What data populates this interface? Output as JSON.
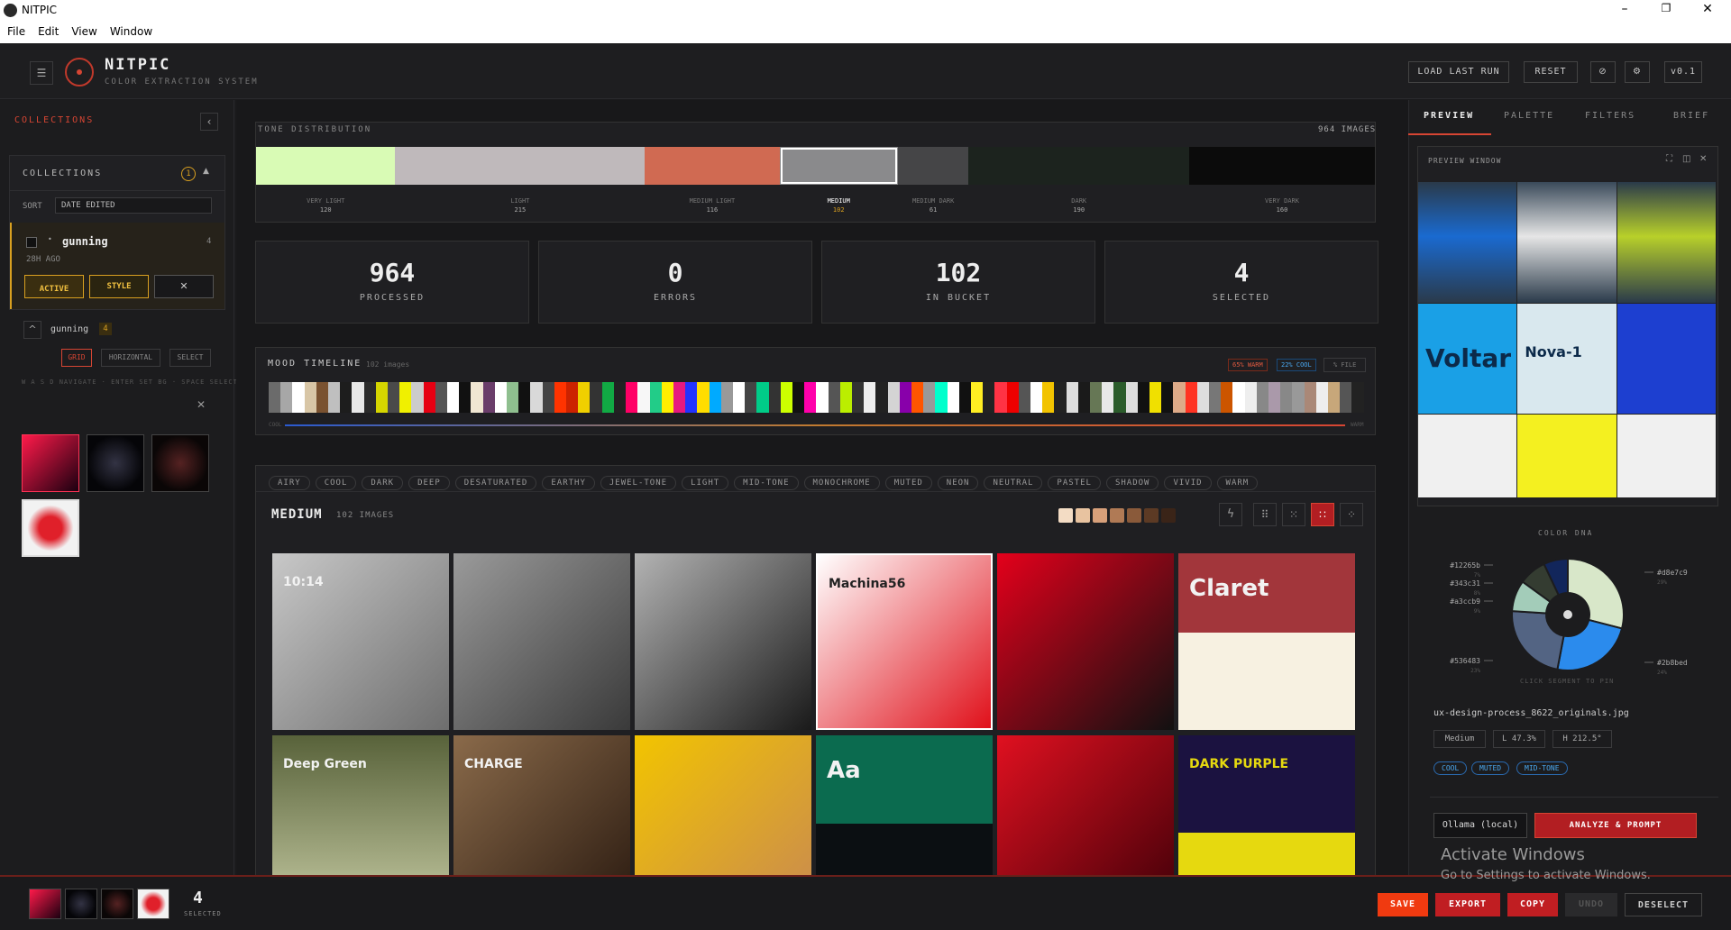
{
  "window": {
    "title": "NITPIC",
    "min": "–",
    "max": "❐",
    "close": "✕"
  },
  "menu": [
    "File",
    "Edit",
    "View",
    "Window"
  ],
  "header": {
    "brand": "NITPIC",
    "tagline": "COLOR EXTRACTION SYSTEM",
    "load_last_run": "LOAD LAST RUN",
    "reset": "RESET",
    "version": "v0.1"
  },
  "sidebar": {
    "title": "COLLECTIONS",
    "collapse_icon": "‹",
    "panel_title": "COLLECTIONS",
    "panel_count": "1",
    "sort_label": "SORT",
    "sort_value": "DATE EDITED",
    "collection": {
      "name": "gunning",
      "count": "4",
      "age": "28H AGO",
      "active": "ACTIVE",
      "style": "STYLE",
      "remove": "✕"
    },
    "group": {
      "name": "gunning",
      "count": "4"
    },
    "view_modes": [
      "GRID",
      "HORIZONTAL",
      "SELECT"
    ],
    "hint": "W A S D NAVIGATE · ENTER SET BG · SPACE SELECT",
    "close": "✕"
  },
  "tone": {
    "title": "TONE DISTRIBUTION",
    "total": "964 IMAGES",
    "segments": [
      {
        "label": "VERY LIGHT",
        "count": "120",
        "color": "#d9fbb5",
        "share": 120
      },
      {
        "label": "LIGHT",
        "count": "215",
        "color": "#bfb9bb",
        "share": 215
      },
      {
        "label": "MEDIUM LIGHT",
        "count": "116",
        "color": "#d06a52",
        "share": 116
      },
      {
        "label": "MEDIUM",
        "count": "102",
        "color": "#8a8a8c",
        "share": 102,
        "active": true
      },
      {
        "label": "MEDIUM DARK",
        "count": "61",
        "color": "#454547",
        "share": 61
      },
      {
        "label": "DARK",
        "count": "190",
        "color": "#1c231e",
        "share": 190
      },
      {
        "label": "VERY DARK",
        "count": "160",
        "color": "#0b0b0b",
        "share": 160
      }
    ]
  },
  "stats": [
    {
      "value": "964",
      "label": "PROCESSED"
    },
    {
      "value": "0",
      "label": "ERRORS"
    },
    {
      "value": "102",
      "label": "IN BUCKET"
    },
    {
      "value": "4",
      "label": "SELECTED"
    }
  ],
  "mood": {
    "title": "MOOD TIMELINE",
    "count": "102 images",
    "warm": "65% WARM",
    "cool": "22% COOL",
    "file": "% FILE",
    "left_label": "COOL",
    "right_label": "WARM",
    "colors": [
      "#6b6b6b",
      "#a7a7a7",
      "#ffffff",
      "#d8c6a6",
      "#7a5230",
      "#bfbfbf",
      "#1d1d1d",
      "#e8e8e8",
      "#2b2b2b",
      "#d6d600",
      "#4a4a4a",
      "#f0f000",
      "#ccc",
      "#e60012",
      "#555",
      "#ffffff",
      "#111",
      "#f0e6d2",
      "#6a3d6a",
      "#ffffff",
      "#8fbf8f",
      "#111",
      "#d9d9d9",
      "#444",
      "#ff3300",
      "#cc2200",
      "#f0d000",
      "#333",
      "#11aa44",
      "#222",
      "#ff0066",
      "#f7f7f7",
      "#22cc88",
      "#ffee00",
      "#e6197f",
      "#2233ff",
      "#ffdd00",
      "#00aaff",
      "#999",
      "#ffffff",
      "#444",
      "#00cc88",
      "#333",
      "#ccff00",
      "#111",
      "#ff00aa",
      "#ffffff",
      "#555",
      "#bbee00",
      "#333",
      "#eee",
      "#222",
      "#d4d4d4",
      "#8800aa",
      "#ff5500",
      "#999",
      "#00ffcc",
      "#ffffff",
      "#111",
      "#ffee22",
      "#222",
      "#ff3344",
      "#ee0000",
      "#555",
      "#ffffff",
      "#f2c300",
      "#222",
      "#dddddd",
      "#1a1a1a",
      "#667755",
      "#e8e8e8",
      "#2b5c2b",
      "#ddd",
      "#111",
      "#f0e000",
      "#111",
      "#ddaa88",
      "#ff3322",
      "#dddddd",
      "#777",
      "#cc5500",
      "#ffffff",
      "#eee",
      "#888",
      "#aa99aa",
      "#888",
      "#999",
      "#aa8877",
      "#eeeeee",
      "#c7a77a",
      "#555",
      "#222"
    ]
  },
  "filters": [
    "AIRY",
    "COOL",
    "DARK",
    "DEEP",
    "DESATURATED",
    "EARTHY",
    "JEWEL-TONE",
    "LIGHT",
    "MID-TONE",
    "MONOCHROME",
    "MUTED",
    "NEON",
    "NEUTRAL",
    "PASTEL",
    "SHADOW",
    "VIVID",
    "WARM"
  ],
  "gallery": {
    "title": "MEDIUM",
    "count": "102 IMAGES",
    "swatches": [
      "#f3dcc4",
      "#e8c3a0",
      "#d7a07a",
      "#b07a55",
      "#8a5a3a",
      "#5c3a24",
      "#3a2418"
    ],
    "items": [
      {
        "bg": "linear-gradient(135deg,#c8c8c8,#6e6e6e)",
        "text": "10:14"
      },
      {
        "bg": "linear-gradient(135deg,#9a9a9a,#3a3a3a)",
        "text": ""
      },
      {
        "bg": "linear-gradient(135deg,#b3b3b3,#1a1a1a)",
        "text": ""
      },
      {
        "bg": "linear-gradient(135deg,#ffffff,#e0101a)",
        "text": "Machina56"
      },
      {
        "bg": "linear-gradient(135deg,#e4001b,#111)",
        "text": ""
      },
      {
        "bg": "linear-gradient(180deg,#a2363b 45%,#f7f1e1 45%)",
        "text": "Claret"
      },
      {
        "bg": "linear-gradient(180deg,#58623a,#c3c8a0)",
        "text": "Deep Green"
      },
      {
        "bg": "linear-gradient(135deg,#8a6a4a,#2a1a10)",
        "text": "CHARGE"
      },
      {
        "bg": "linear-gradient(135deg,#f2c400,#c98a50)",
        "text": ""
      },
      {
        "bg": "linear-gradient(180deg,#0b6b4f 50%,#0b0f12 50%)",
        "text": "Aa"
      },
      {
        "bg": "linear-gradient(135deg,#e01020,#400008)",
        "text": ""
      },
      {
        "bg": "linear-gradient(180deg,#1b1240 55%,#e6d90f 55%)",
        "text": "DARK PURPLE"
      }
    ]
  },
  "right": {
    "tabs": [
      "PREVIEW",
      "PALETTE",
      "FILTERS",
      "BRIEF"
    ],
    "preview_title": "PREVIEW WINDOW",
    "dna_title": "COLOR DNA",
    "dna_hint": "CLICK SEGMENT TO PIN",
    "dna": [
      {
        "hex": "#d8e7c9",
        "pct": "29%",
        "color": "#d8e7c9",
        "v": 29
      },
      {
        "hex": "#2b8bed",
        "pct": "24%",
        "color": "#2b8bed",
        "v": 24
      },
      {
        "hex": "#536483",
        "pct": "23%",
        "color": "#536483",
        "v": 23
      },
      {
        "hex": "#a3ccb9",
        "pct": "9%",
        "color": "#a3ccb9",
        "v": 9
      },
      {
        "hex": "#343c31",
        "pct": "8%",
        "color": "#343c31",
        "v": 8
      },
      {
        "hex": "#12265b",
        "pct": "7%",
        "color": "#12265b",
        "v": 7
      }
    ],
    "filename": "ux-design-process_8622_originals.jpg",
    "tone_tag": "Medium",
    "lightness": "L 47.3%",
    "hue": "H 212.5°",
    "tags": [
      "COOL",
      "MUTED",
      "MID-TONE"
    ],
    "model": "Ollama (local)",
    "analyze": "ANALYZE & PROMPT",
    "preview_panels": [
      {
        "bg": "linear-gradient(180deg,#2a3a4a,#1a6ad0 45%,#2a3a4a)",
        "label": ""
      },
      {
        "bg": "linear-gradient(180deg,#3a4a5a,#e6e6e6 45%,#2a3a4a)",
        "label": ""
      },
      {
        "bg": "linear-gradient(180deg,#2a3a4a,#b8d02a 45%,#2a3a4a)",
        "label": ""
      },
      {
        "bg": "#1aa0e6",
        "label": "Voltar"
      },
      {
        "bg": "#d9e8ee",
        "label": "Nova-1"
      },
      {
        "bg": "#1d3fd0",
        "label": ""
      },
      {
        "bg": "#f0f0f0",
        "label": ""
      },
      {
        "bg": "#f4f020",
        "label": ""
      },
      {
        "bg": "#f0f0f0",
        "label": ""
      }
    ]
  },
  "footer": {
    "count": "4",
    "count_label": "SELECTED",
    "save": "SAVE",
    "export": "EXPORT",
    "copy": "COPY",
    "undo": "UNDO",
    "deselect": "DESELECT"
  },
  "watermark": {
    "line1": "Activate Windows",
    "line2": "Go to Settings to activate Windows."
  }
}
